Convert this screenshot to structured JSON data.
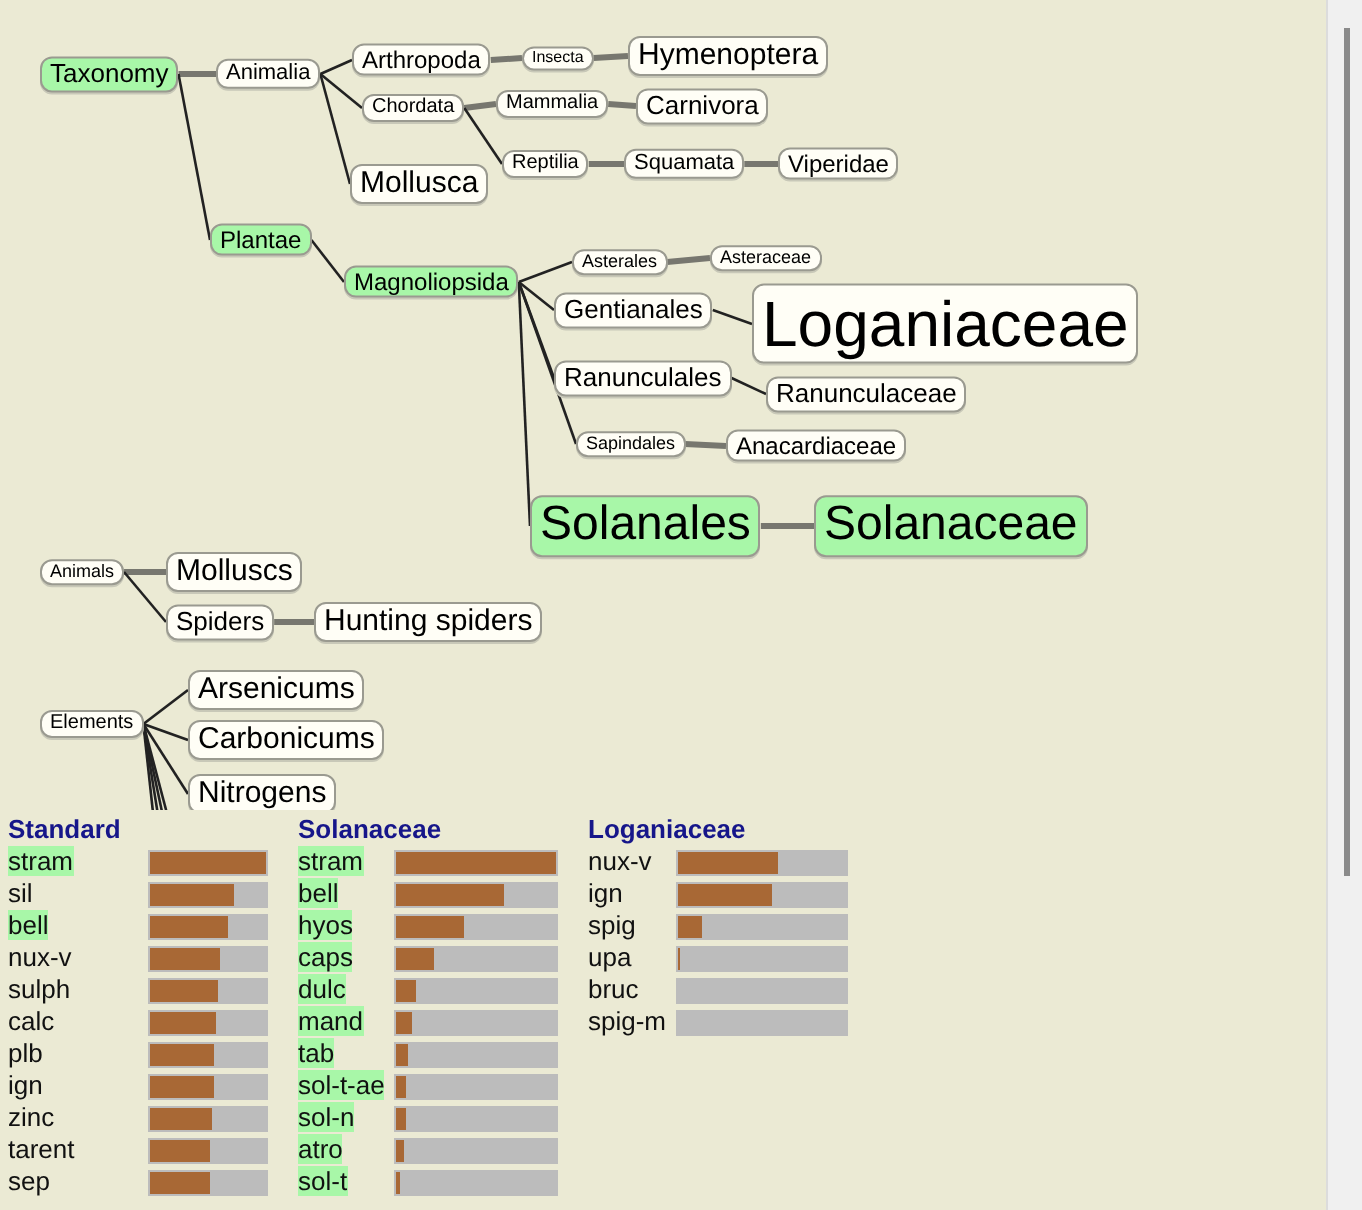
{
  "mind_map": {
    "trees": [
      {
        "label": "Taxonomy",
        "highlighted": true,
        "children": [
          {
            "label": "Animalia",
            "highlighted": false,
            "children": [
              {
                "label": "Arthropoda",
                "highlighted": false,
                "children": [
                  {
                    "label": "Insecta",
                    "highlighted": false,
                    "children": [
                      {
                        "label": "Hymenoptera",
                        "highlighted": false
                      }
                    ]
                  }
                ]
              },
              {
                "label": "Chordata",
                "highlighted": false,
                "children": [
                  {
                    "label": "Mammalia",
                    "highlighted": false,
                    "children": [
                      {
                        "label": "Carnivora",
                        "highlighted": false
                      }
                    ]
                  },
                  {
                    "label": "Reptilia",
                    "highlighted": false,
                    "children": [
                      {
                        "label": "Squamata",
                        "highlighted": false,
                        "children": [
                          {
                            "label": "Viperidae",
                            "highlighted": false
                          }
                        ]
                      }
                    ]
                  }
                ]
              },
              {
                "label": "Mollusca",
                "highlighted": false
              }
            ]
          },
          {
            "label": "Plantae",
            "highlighted": true,
            "children": [
              {
                "label": "Magnoliopsida",
                "highlighted": true,
                "children": [
                  {
                    "label": "Asterales",
                    "highlighted": false,
                    "children": [
                      {
                        "label": "Asteraceae",
                        "highlighted": false
                      }
                    ]
                  },
                  {
                    "label": "Gentianales",
                    "highlighted": false,
                    "children": [
                      {
                        "label": "Loganiaceae",
                        "highlighted": false
                      }
                    ]
                  },
                  {
                    "label": "Ranunculales",
                    "highlighted": false,
                    "children": [
                      {
                        "label": "Ranunculaceae",
                        "highlighted": false
                      }
                    ]
                  },
                  {
                    "label": "Sapindales",
                    "highlighted": false,
                    "children": [
                      {
                        "label": "Anacardiaceae",
                        "highlighted": false
                      }
                    ]
                  },
                  {
                    "label": "Solanales",
                    "highlighted": true,
                    "children": [
                      {
                        "label": "Solanaceae",
                        "highlighted": true
                      }
                    ]
                  }
                ]
              }
            ]
          }
        ]
      },
      {
        "label": "Animals",
        "highlighted": false,
        "children": [
          {
            "label": "Molluscs",
            "highlighted": false
          },
          {
            "label": "Spiders",
            "highlighted": false,
            "children": [
              {
                "label": "Hunting spiders",
                "highlighted": false
              }
            ]
          }
        ]
      },
      {
        "label": "Elements",
        "highlighted": false,
        "children": [
          {
            "label": "Arsenicums",
            "highlighted": false
          },
          {
            "label": "Carbonicums",
            "highlighted": false
          },
          {
            "label": "Nitrogens",
            "highlighted": false
          }
        ]
      }
    ]
  },
  "remedy_columns": [
    {
      "title": "Standard",
      "rows": [
        {
          "remedy": "stram",
          "highlighted": true,
          "level": 1.0
        },
        {
          "remedy": "sil",
          "highlighted": false,
          "level": 0.72
        },
        {
          "remedy": "bell",
          "highlighted": true,
          "level": 0.67
        },
        {
          "remedy": "nux-v",
          "highlighted": false,
          "level": 0.6
        },
        {
          "remedy": "sulph",
          "highlighted": false,
          "level": 0.58
        },
        {
          "remedy": "calc",
          "highlighted": false,
          "level": 0.57
        },
        {
          "remedy": "plb",
          "highlighted": false,
          "level": 0.55
        },
        {
          "remedy": "ign",
          "highlighted": false,
          "level": 0.55
        },
        {
          "remedy": "zinc",
          "highlighted": false,
          "level": 0.53
        },
        {
          "remedy": "tarent",
          "highlighted": false,
          "level": 0.52
        },
        {
          "remedy": "sep",
          "highlighted": false,
          "level": 0.52
        }
      ]
    },
    {
      "title": "Solanaceae",
      "rows": [
        {
          "remedy": "stram",
          "highlighted": true,
          "level": 1.0
        },
        {
          "remedy": "bell",
          "highlighted": true,
          "level": 0.67
        },
        {
          "remedy": "hyos",
          "highlighted": true,
          "level": 0.42
        },
        {
          "remedy": "caps",
          "highlighted": true,
          "level": 0.24
        },
        {
          "remedy": "dulc",
          "highlighted": true,
          "level": 0.13
        },
        {
          "remedy": "mand",
          "highlighted": true,
          "level": 0.1
        },
        {
          "remedy": "tab",
          "highlighted": true,
          "level": 0.08
        },
        {
          "remedy": "sol-t-ae",
          "highlighted": true,
          "level": 0.06
        },
        {
          "remedy": "sol-n",
          "highlighted": true,
          "level": 0.06
        },
        {
          "remedy": "atro",
          "highlighted": true,
          "level": 0.05
        },
        {
          "remedy": "sol-t",
          "highlighted": true,
          "level": 0.03
        }
      ]
    },
    {
      "title": "Loganiaceae",
      "rows": [
        {
          "remedy": "nux-v",
          "highlighted": false,
          "level": 0.59
        },
        {
          "remedy": "ign",
          "highlighted": false,
          "level": 0.56
        },
        {
          "remedy": "spig",
          "highlighted": false,
          "level": 0.14
        },
        {
          "remedy": "upa",
          "highlighted": false,
          "level": 0.01
        },
        {
          "remedy": "bruc",
          "highlighted": false,
          "level": 0
        },
        {
          "remedy": "spig-m",
          "highlighted": false,
          "level": 0
        }
      ]
    }
  ]
}
